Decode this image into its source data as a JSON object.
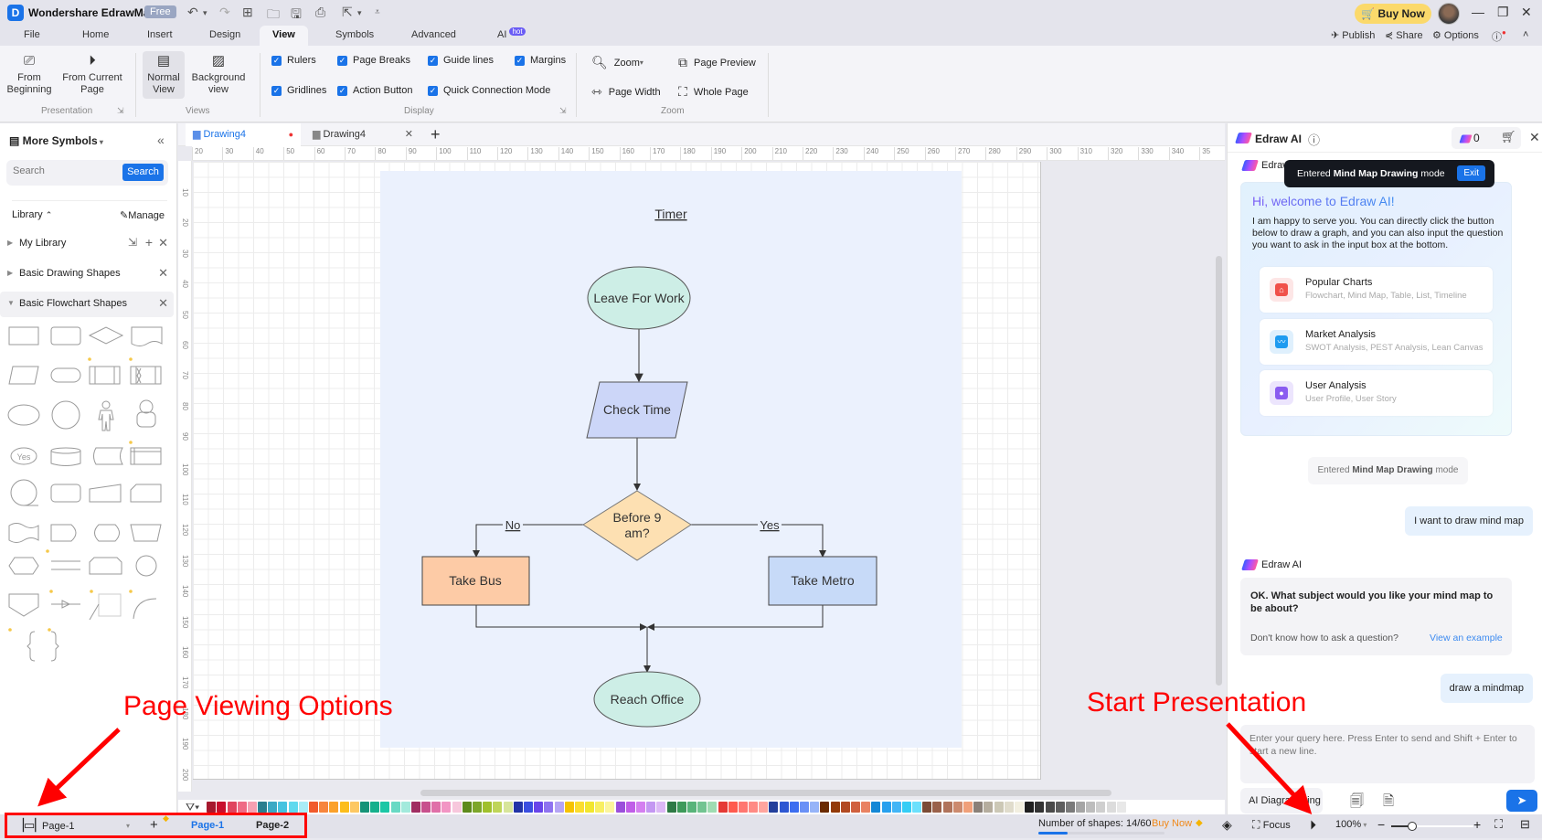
{
  "app": {
    "title": "Wondershare EdrawMax",
    "plan_badge": "Free",
    "buy_now": "Buy Now"
  },
  "ribbon_tabs": [
    {
      "label": "File"
    },
    {
      "label": "Home"
    },
    {
      "label": "Insert"
    },
    {
      "label": "Design"
    },
    {
      "label": "View",
      "active": true
    },
    {
      "label": "Symbols"
    },
    {
      "label": "Advanced"
    },
    {
      "label": "AI",
      "badge": "hot"
    }
  ],
  "ribbon_right": {
    "publish": "Publish",
    "share": "Share",
    "options": "Options"
  },
  "ribbon": {
    "presentation": {
      "group_label": "Presentation",
      "from_beginning": "From\nBeginning",
      "from_current": "From Current\nPage"
    },
    "views": {
      "group_label": "Views",
      "normal_view": "Normal\nView",
      "background_view": "Background\nview"
    },
    "display": {
      "group_label": "Display",
      "checkboxes": [
        {
          "label": "Rulers",
          "checked": true
        },
        {
          "label": "Page Breaks",
          "checked": true
        },
        {
          "label": "Guide lines",
          "checked": true
        },
        {
          "label": "Margins",
          "checked": true
        },
        {
          "label": "Gridlines",
          "checked": true
        },
        {
          "label": "Action Button",
          "checked": true
        },
        {
          "label": "Quick Connection Mode",
          "checked": true
        }
      ]
    },
    "zoom": {
      "group_label": "Zoom",
      "zoom": "Zoom",
      "page_preview": "Page Preview",
      "page_width": "Page Width",
      "whole_page": "Whole Page"
    }
  },
  "left_panel": {
    "title": "More Symbols",
    "search_placeholder": "Search",
    "search_button": "Search",
    "library_label": "Library",
    "manage_label": "Manage",
    "libraries": [
      {
        "label": "My Library"
      },
      {
        "label": "Basic Drawing Shapes"
      },
      {
        "label": "Basic Flowchart Shapes",
        "expanded": true
      }
    ],
    "shape_yes_label": "Yes"
  },
  "doc_tabs": [
    {
      "label": "Drawing4",
      "active": true,
      "unsaved": true
    },
    {
      "label": "Drawing4",
      "active": false
    }
  ],
  "rulers": {
    "horizontal": [
      "20",
      "30",
      "40",
      "50",
      "60",
      "70",
      "80",
      "90",
      "100",
      "110",
      "120",
      "130",
      "140",
      "150",
      "160",
      "170",
      "180",
      "190",
      "200",
      "210",
      "220",
      "230",
      "240",
      "250",
      "260",
      "270",
      "280",
      "290",
      "300",
      "310",
      "320",
      "330",
      "340",
      "35"
    ],
    "vertical": [
      "10",
      "20",
      "30",
      "40",
      "50",
      "60",
      "70",
      "80",
      "90",
      "100",
      "110",
      "120",
      "130",
      "140",
      "150",
      "160",
      "170",
      "180",
      "190",
      "200"
    ]
  },
  "diagram": {
    "title": "Timer",
    "nodes": {
      "start": "Leave For Work",
      "input": "Check Time",
      "decision": "Before 9 am?",
      "left": "Take Bus",
      "right": "Take Metro",
      "end": "Reach Office"
    },
    "edge_labels": {
      "no": "No",
      "yes": "Yes"
    },
    "colors": {
      "start": "#cdeee6",
      "input": "#ccd6f8",
      "decision": "#fde0b2",
      "left": "#fdcba6",
      "right": "#c7daf8",
      "end": "#cdeee6",
      "page_bg": "#ebf1fd"
    }
  },
  "palette": [
    "#a6192e",
    "#c8102e",
    "#e0455e",
    "#ef6b84",
    "#f5a0b1",
    "#2a7f8f",
    "#3aa9c4",
    "#45c3e0",
    "#5fd9ee",
    "#a9ecf6",
    "#f15a2b",
    "#f7853c",
    "#fba12a",
    "#fcbd1b",
    "#fdc862",
    "#169478",
    "#16b08c",
    "#1cc7a6",
    "#68d9c4",
    "#a2eadc",
    "#a02e62",
    "#c8508d",
    "#e06fa8",
    "#f295c4",
    "#f7c7dc",
    "#5e8a1c",
    "#7da62a",
    "#a0c02c",
    "#bfd558",
    "#d7e59a",
    "#2233a6",
    "#3a4ee0",
    "#6945ea",
    "#8f73f0",
    "#b5a4f5",
    "#f6c300",
    "#fbdd2e",
    "#f2e62e",
    "#f8ef62",
    "#fbf59c",
    "#9b4fdb",
    "#c05ee8",
    "#d47ff0",
    "#c497f2",
    "#dcb8f6",
    "#2e7a45",
    "#3e9a5a",
    "#58b47a",
    "#72c491",
    "#9fdcb2",
    "#e53935",
    "#ff5a4e",
    "#ff7670",
    "#ff8a84",
    "#ffa59e",
    "#233f9b",
    "#2d57d2",
    "#3d6ef0",
    "#6a91f6",
    "#96b4f8",
    "#6b2b00",
    "#933a08",
    "#b24a22",
    "#d0603e",
    "#e98262",
    "#1488d6",
    "#27a0ee",
    "#42b5f6",
    "#34cdf5",
    "#6be0fc",
    "#7b4b35",
    "#9a614a",
    "#b0735b",
    "#cc8a6e",
    "#f0a07a",
    "#8a8078",
    "#b5ad9e",
    "#ccc8b6",
    "#e0dccc",
    "#f2efe0",
    "#1f1f1f",
    "#333333",
    "#4a4a4a",
    "#5e5e5e",
    "#7b7b7b",
    "#a5a5a5",
    "#bdbdbd",
    "#cfcfcf",
    "#dcdcdc",
    "#e8e8e8"
  ],
  "ai_panel": {
    "title": "Edraw AI",
    "credits": "0",
    "sender_name": "Edraw AI",
    "toast": {
      "prefix": "Entered ",
      "bold": "Mind Map Drawing",
      "suffix": " mode",
      "exit": "Exit"
    },
    "welcome_title": "Hi, welcome to Edraw AI!",
    "welcome_text": "I am happy to serve you. You can directly click the button below to draw a graph, and you can also input the question you want to ask in the input box at the bottom.",
    "cards": [
      {
        "title": "Popular Charts",
        "subtitle": "Flowchart, Mind Map, Table, List, Timeline",
        "color": "#f0514a",
        "bg": "#fde6e6"
      },
      {
        "title": "Market Analysis",
        "subtitle": "SWOT Analysis, PEST Analysis, Lean Canvas",
        "color": "#1e9bf0",
        "bg": "#dff0fd"
      },
      {
        "title": "User Analysis",
        "subtitle": "User Profile, User Story",
        "color": "#8a5cf0",
        "bg": "#ece5fd"
      }
    ],
    "mode_pill": {
      "prefix": "Entered ",
      "bold": "Mind Map Drawing",
      "suffix": " mode"
    },
    "user_msg_1": "I want to draw mind map",
    "ai_reply": "OK. What subject would you like your mind map to be about?",
    "ai_help": "Don't know how to ask a question?",
    "ai_help_link": "View an example",
    "user_msg_2": "draw a mindmap",
    "input_placeholder": "Enter your query here. Press Enter to send and Shift + Enter to start a new line.",
    "mode_select": "AI Diagramming"
  },
  "status_bar": {
    "current_page": "Page-1",
    "pages": [
      {
        "label": "Page-1",
        "active": true
      },
      {
        "label": "Page-2",
        "active": false
      }
    ],
    "shapes_count": "Number of shapes: 14/60",
    "shapes_progress": 0.233,
    "buy_now": "Buy Now",
    "focus": "Focus",
    "zoom": "100%",
    "zoom_level": 1.0
  },
  "annotations": {
    "page_viewing": "Page Viewing Options",
    "start_presentation": "Start Presentation"
  }
}
